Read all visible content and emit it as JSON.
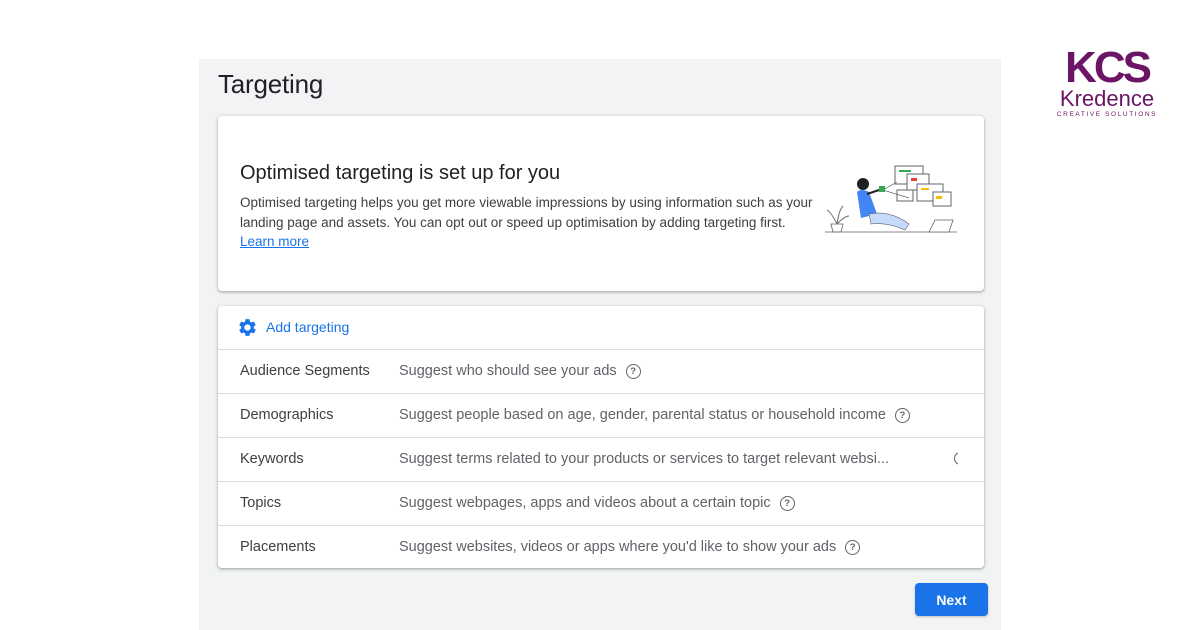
{
  "page": {
    "title": "Targeting"
  },
  "hero": {
    "title": "Optimised targeting is set up for you",
    "body": "Optimised targeting helps you get more viewable impressions by using information such as your landing page and assets. You can opt out or speed up optimisation by adding targeting first.",
    "link_label": "Learn more",
    "illustration_icon": "person-with-screens-illustration"
  },
  "targeting": {
    "add_label": "Add targeting",
    "add_icon": "gear-icon",
    "rows": [
      {
        "name": "Audience Segments",
        "description": "Suggest who should see your ads"
      },
      {
        "name": "Demographics",
        "description": "Suggest people based on age, gender, parental status or household income"
      },
      {
        "name": "Keywords",
        "description": "Suggest terms related to your products or services to target relevant websi..."
      },
      {
        "name": "Topics",
        "description": "Suggest webpages, apps and videos about a certain topic"
      },
      {
        "name": "Placements",
        "description": "Suggest websites, videos or apps where you'd like to show your ads"
      }
    ]
  },
  "footer": {
    "next_label": "Next"
  },
  "logo": {
    "mark": "KCS",
    "name": "Kredence",
    "tagline": "CREATIVE SOLUTIONS"
  },
  "colors": {
    "accent": "#1a73e8",
    "logo_purple": "#6b1566",
    "panel_bg": "#f1f3f4"
  }
}
